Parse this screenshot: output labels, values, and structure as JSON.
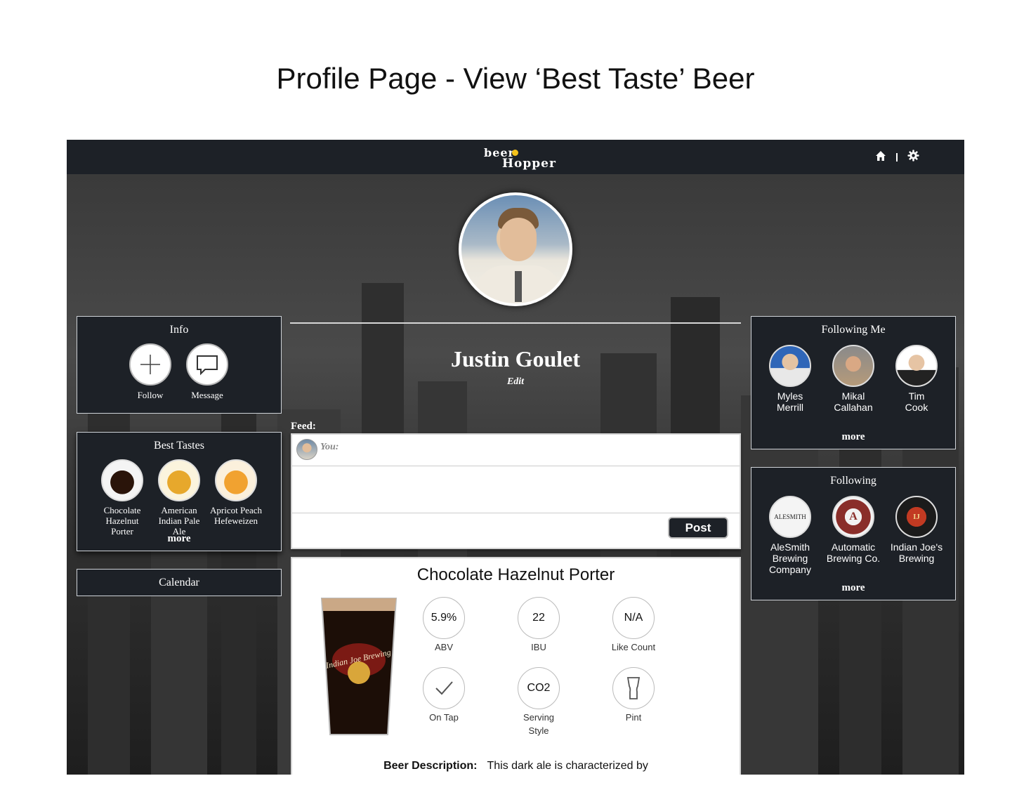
{
  "doc_title": "Profile Page - View ‘Best Taste’ Beer",
  "brand": {
    "line1": "beer",
    "line2": "Hopper"
  },
  "colors": {
    "nav_bg": "#1d2127",
    "accent_yellow": "#f4c21a",
    "panel_border": "#cfd3d8"
  },
  "nav": {
    "icons": [
      "home-icon",
      "gear-icon"
    ]
  },
  "profile": {
    "name": "Justin Goulet",
    "edit_label": "Edit"
  },
  "info": {
    "title": "Info",
    "follow_label": "Follow",
    "message_label": "Message"
  },
  "best_tastes": {
    "title": "Best Tastes",
    "items": [
      {
        "label": "Chocolate Hazelnut Porter"
      },
      {
        "label": "American Indian Pale Ale"
      },
      {
        "label": "Apricot Peach Hefeweizen"
      }
    ],
    "more_label": "more"
  },
  "calendar": {
    "label": "Calendar"
  },
  "feed": {
    "label": "Feed:",
    "you_label": "You:",
    "post_label": "Post"
  },
  "following_me": {
    "title": "Following Me",
    "people": [
      {
        "first": "Myles",
        "last": "Merrill"
      },
      {
        "first": "Mikal",
        "last": "Callahan"
      },
      {
        "first": "Tim",
        "last": "Cook"
      }
    ],
    "more_label": "more"
  },
  "following": {
    "title": "Following",
    "breweries": [
      {
        "lines": [
          "AleSmith",
          "Brewing",
          "Company"
        ],
        "logo_text": "ALESMITH"
      },
      {
        "lines": [
          "Automatic",
          "Brewing Co."
        ],
        "logo_text": "A"
      },
      {
        "lines": [
          "Indian Joe's",
          "Brewing"
        ],
        "logo_text": "IJ"
      }
    ],
    "more_label": "more"
  },
  "beer": {
    "name": "Chocolate Hazelnut Porter",
    "glass_text": "Indian Joe Brewing",
    "abv": {
      "value": "5.9%",
      "label": "ABV"
    },
    "ibu": {
      "value": "22",
      "label": "IBU"
    },
    "likes": {
      "value": "N/A",
      "label": "Like Count"
    },
    "on_tap": {
      "label": "On Tap"
    },
    "serving": {
      "value": "CO2",
      "label_line1": "Serving",
      "label_line2": "Style"
    },
    "pint": {
      "label": "Pint"
    },
    "description_label": "Beer Description:",
    "description_text": "This dark ale is characterized by"
  }
}
